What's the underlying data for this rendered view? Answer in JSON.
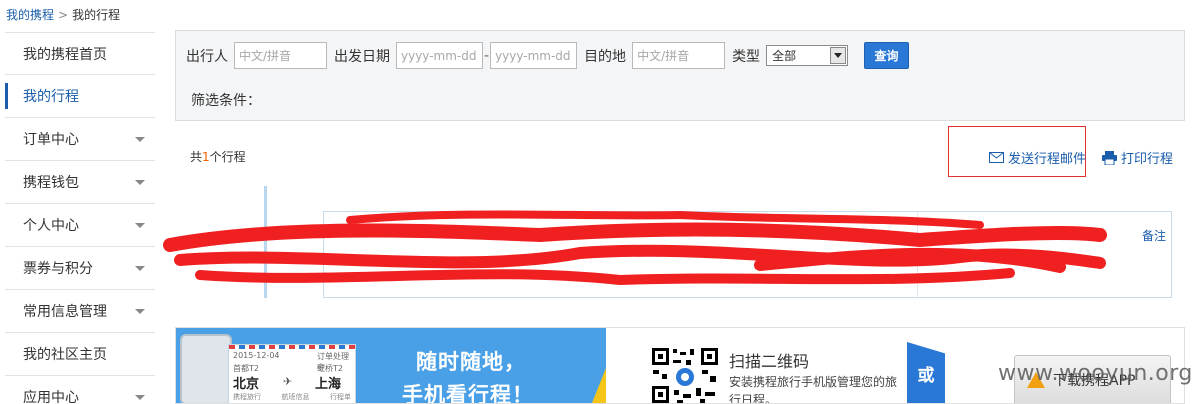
{
  "breadcrumb": {
    "home": "我的携程",
    "separator": ">",
    "current": "我的行程"
  },
  "sidebar": {
    "items": [
      {
        "label": "我的携程首页",
        "has_arrow": false
      },
      {
        "label": "我的行程",
        "has_arrow": false,
        "active": true
      },
      {
        "label": "订单中心",
        "has_arrow": true
      },
      {
        "label": "携程钱包",
        "has_arrow": true
      },
      {
        "label": "个人中心",
        "has_arrow": true
      },
      {
        "label": "票券与积分",
        "has_arrow": true
      },
      {
        "label": "常用信息管理",
        "has_arrow": true
      },
      {
        "label": "我的社区主页",
        "has_arrow": false
      },
      {
        "label": "应用中心",
        "has_arrow": true
      }
    ]
  },
  "filter": {
    "traveler_label": "出行人",
    "traveler_placeholder": "中文/拼音",
    "date_label": "出发日期",
    "date_from_placeholder": "yyyy-mm-dd",
    "date_to_placeholder": "yyyy-mm-dd",
    "destination_label": "目的地",
    "destination_placeholder": "中文/拼音",
    "type_label": "类型",
    "type_value": "全部",
    "search_button": "查询",
    "conditions_label": "筛选条件："
  },
  "results": {
    "count_prefix": "共",
    "count": "1",
    "count_suffix": "个行程",
    "send_email": "发送行程邮件",
    "print": "打印行程",
    "remark": "备注"
  },
  "banner": {
    "ticket_date": "2015-12-04",
    "ticket_status": "订单处理中",
    "ticket_from_airport": "首都T2",
    "ticket_to_airport": "虹桥T2",
    "ticket_from_city": "北京",
    "ticket_to_city": "上海",
    "ticket_foot_1": "携程旅行",
    "ticket_foot_2": "航班信息",
    "ticket_foot_3": "行程单",
    "slogan_line1": "随时随地，",
    "slogan_line2": "手机看行程！",
    "qr_title": "扫描二维码",
    "qr_desc": "安装携程旅行手机版管理您的旅行日程。",
    "or_label": "或",
    "download_button": "下载携程APP"
  },
  "watermark": "www.wooyun.org",
  "colors": {
    "accent": "#1a5dab",
    "button": "#2a78d6",
    "highlight_border": "#e03030",
    "count": "#f06000",
    "scribble": "#f02020"
  }
}
